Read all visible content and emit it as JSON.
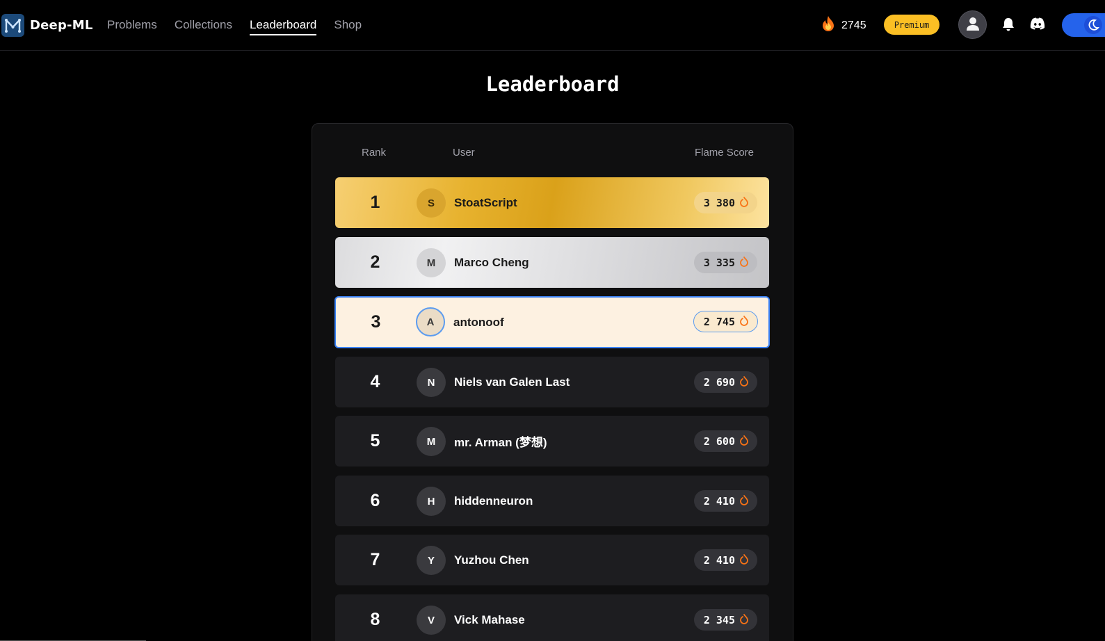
{
  "header": {
    "logo_text": "Deep-ML",
    "nav": [
      {
        "label": "Problems",
        "active": false
      },
      {
        "label": "Collections",
        "active": false
      },
      {
        "label": "Leaderboard",
        "active": true
      },
      {
        "label": "Shop",
        "active": false
      }
    ],
    "flame_count": "2745",
    "premium_label": "Premium",
    "icons": [
      "fire-icon",
      "user-icon",
      "bell-icon",
      "discord-icon",
      "moon-icon"
    ]
  },
  "page": {
    "title": "Leaderboard"
  },
  "table": {
    "columns": {
      "rank": "Rank",
      "user": "User",
      "score": "Flame Score"
    },
    "rows": [
      {
        "rank": "1",
        "initial": "S",
        "name": "StoatScript",
        "score": "3 380",
        "style": "gold"
      },
      {
        "rank": "2",
        "initial": "M",
        "name": "Marco Cheng",
        "score": "3 335",
        "style": "silver"
      },
      {
        "rank": "3",
        "initial": "A",
        "name": "antonoof",
        "score": "2 745",
        "style": "current-user"
      },
      {
        "rank": "4",
        "initial": "N",
        "name": "Niels van Galen Last",
        "score": "2 690",
        "style": "default"
      },
      {
        "rank": "5",
        "initial": "M",
        "name": "mr. Arman (梦想)",
        "score": "2 600",
        "style": "default"
      },
      {
        "rank": "6",
        "initial": "H",
        "name": "hiddenneuron",
        "score": "2 410",
        "style": "default"
      },
      {
        "rank": "7",
        "initial": "Y",
        "name": "Yuzhou Chen",
        "score": "2 410",
        "style": "default"
      },
      {
        "rank": "8",
        "initial": "V",
        "name": "Vick Mahase",
        "score": "2 345",
        "style": "default"
      }
    ]
  },
  "colors": {
    "background": "#000000",
    "accent_blue": "#3b82f6",
    "premium_yellow": "#fbbf24",
    "flame_orange": "#f97316",
    "gold": "#e7b22e",
    "silver": "#dcdcde"
  }
}
